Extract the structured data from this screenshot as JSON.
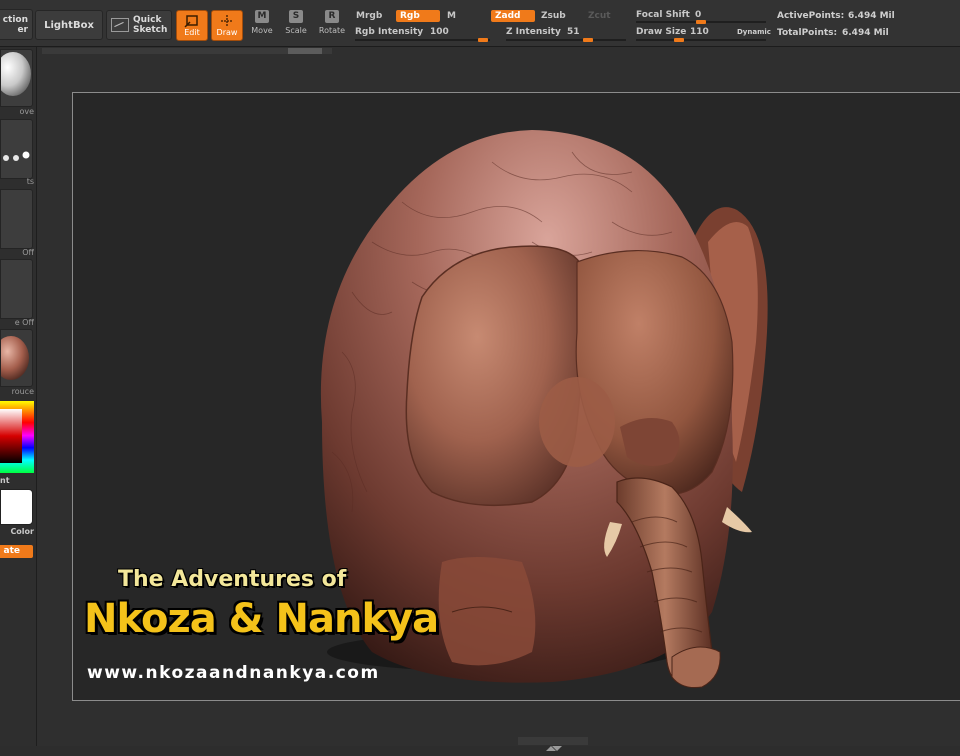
{
  "toolbar": {
    "selection_label": "ction\ner",
    "lightbox_label": "LightBox",
    "quick_sketch_line1": "Quick",
    "quick_sketch_line2": "Sketch",
    "edit_label": "Edit",
    "draw_label": "Draw",
    "move_label": "Move",
    "scale_label": "Scale",
    "rotate_label": "Rotate",
    "move_glyph": "M",
    "scale_glyph": "S",
    "rotate_glyph": "R",
    "mrgb_label": "Mrgb",
    "rgb_label": "Rgb",
    "m_label": "M",
    "zadd_label": "Zadd",
    "zsub_label": "Zsub",
    "zcut_label": "Zcut",
    "rgb_intensity_label": "Rgb Intensity",
    "rgb_intensity_value": "100",
    "z_intensity_label": "Z Intensity",
    "z_intensity_value": "51",
    "focal_shift_label": "Focal Shift",
    "focal_shift_value": "0",
    "draw_size_label": "Draw Size",
    "draw_size_value": "110",
    "dynamic_label": "Dynamic",
    "active_points_label": "ActivePoints:",
    "active_points_value": "6.494 Mil",
    "total_points_label": "TotalPoints:",
    "total_points_value": "6.494 Mil"
  },
  "left_tray": {
    "brush_caption": "ove",
    "stroke_caption": "ts",
    "alpha_caption": "Off",
    "texture_caption": "e  Off",
    "material_caption": "rouce",
    "color_caption": "nt",
    "swatch_caption": "Color",
    "orange_button_label": "ate"
  },
  "canvas": {
    "logo_line1": "The Adventures of",
    "logo_line2": "Nkoza & Nankya",
    "logo_url": "www.nkozaandnankya.com"
  },
  "colors": {
    "accent": "#f07a1a",
    "sculpt_base": "#a5675a"
  }
}
